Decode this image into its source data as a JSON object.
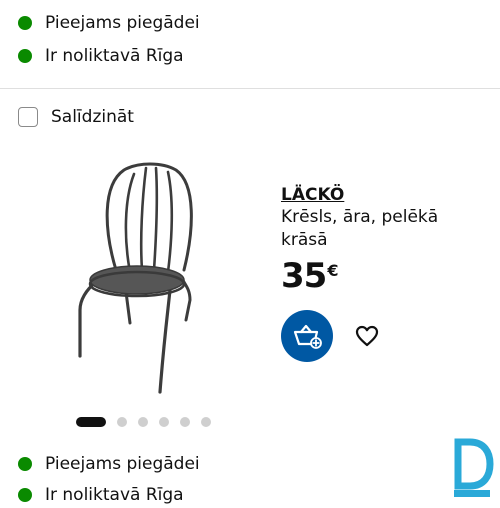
{
  "top_availability": {
    "delivery": "Pieejams piegādei",
    "store": "Ir noliktavā Rīga"
  },
  "compare": {
    "label": "Salīdzināt",
    "checked": false
  },
  "product": {
    "name": "LÄCKÖ",
    "description": "Krēsls, āra, pelēkā krāsā",
    "price_integer": "35",
    "price_currency": "€"
  },
  "carousel": {
    "total": 6,
    "active": 1
  },
  "bottom_availability": {
    "delivery": "Pieejams piegādei",
    "store": "Ir noliktavā Rīga"
  },
  "colors": {
    "availability_dot": "#0a8a00",
    "cart_button": "#0558a3",
    "logo": "#2aa9d8"
  },
  "icons": {
    "cart": "basket-plus-icon",
    "favourite": "heart-outline-icon",
    "logo": "d-logo-icon"
  }
}
